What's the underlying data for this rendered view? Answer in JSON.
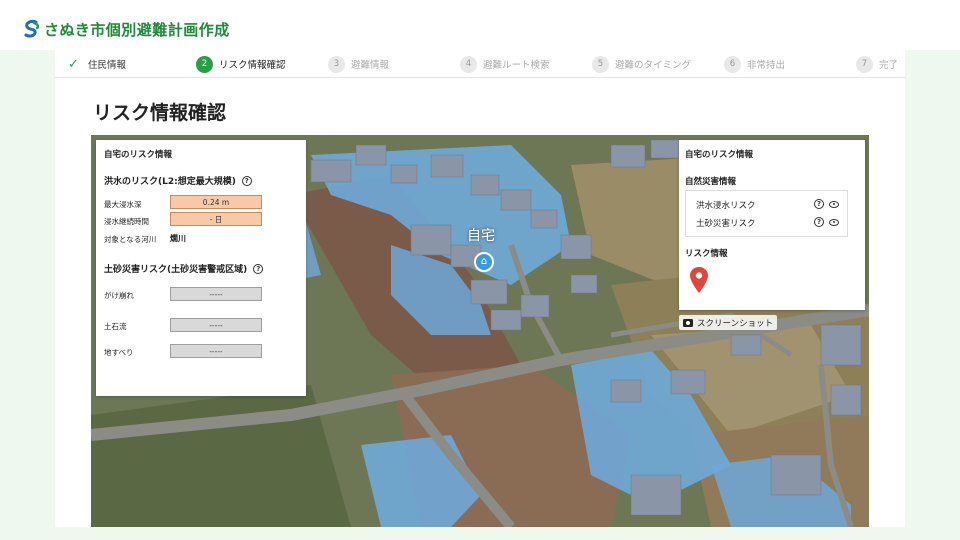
{
  "app": {
    "title": "さぬき市個別避難計画作成"
  },
  "steps": [
    {
      "num": "✓",
      "label": "住民情報",
      "state": "done"
    },
    {
      "num": "2",
      "label": "リスク情報確認",
      "state": "active"
    },
    {
      "num": "3",
      "label": "避難情報",
      "state": "pending"
    },
    {
      "num": "4",
      "label": "避難ルート検索",
      "state": "pending"
    },
    {
      "num": "5",
      "label": "避難のタイミング",
      "state": "pending"
    },
    {
      "num": "6",
      "label": "非常持出",
      "state": "pending"
    },
    {
      "num": "7",
      "label": "完了",
      "state": "pending"
    }
  ],
  "page": {
    "heading": "リスク情報確認"
  },
  "left_panel": {
    "title": "自宅のリスク情報",
    "flood": {
      "heading": "洪水のリスク(L2:想定最大規模)",
      "max_depth_label": "最大浸水深",
      "max_depth_value": "0.24 m",
      "duration_label": "浸水継続時間",
      "duration_value": "- 日",
      "river_label": "対象となる河川",
      "river_value": "燗川"
    },
    "landslide": {
      "heading": "土砂災害リスク(土砂災害警戒区域)",
      "items": [
        {
          "label": "がけ崩れ",
          "value": "-----"
        },
        {
          "label": "土石流",
          "value": "-----"
        },
        {
          "label": "地すべり",
          "value": "-----"
        }
      ]
    }
  },
  "right_panel": {
    "title": "自宅のリスク情報",
    "natural_heading": "自然災害情報",
    "risks": [
      {
        "label": "洪水浸水リスク"
      },
      {
        "label": "土砂災害リスク"
      }
    ],
    "risk_info_heading": "リスク情報"
  },
  "map": {
    "home_label": "自宅",
    "screenshot_label": "スクリーンショット"
  },
  "colors": {
    "accent": "#2a9d46",
    "flood_blue": "#6fa8d8",
    "pin_red": "#e0473a"
  },
  "icons": {
    "logo": "sanuki-logo-icon",
    "help": "question-circle-icon",
    "visibility": "eye-icon",
    "pin": "map-pin-icon",
    "camera": "camera-icon",
    "home": "home-icon"
  }
}
